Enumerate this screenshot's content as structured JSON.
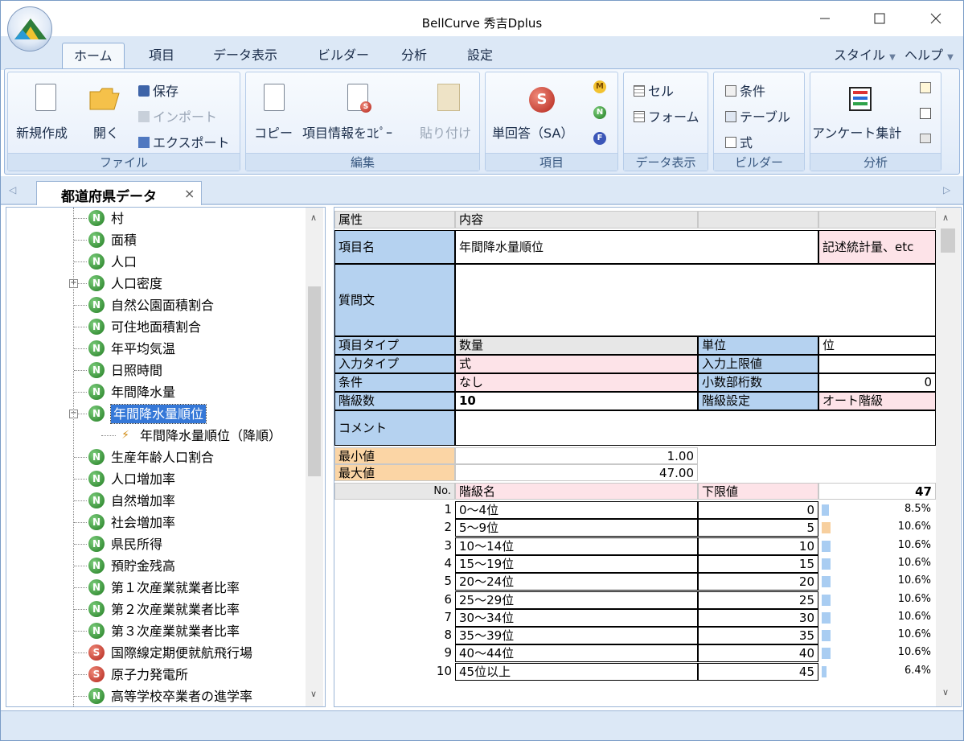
{
  "window": {
    "title": "BellCurve 秀吉Dplus"
  },
  "ribbon_tabs": [
    "ホーム",
    "項目",
    "データ表示",
    "ビルダー",
    "分析",
    "設定"
  ],
  "ribbon_right": {
    "style": "スタイル",
    "help": "ヘルプ"
  },
  "groups": {
    "file": {
      "label": "ファイル",
      "new": "新規作成",
      "open": "開く",
      "save": "保存",
      "import": "インポート",
      "export": "エクスポート"
    },
    "edit": {
      "label": "編集",
      "copy": "コピー",
      "copy_info": "項目情報をｺﾋﾟｰ",
      "paste": "貼り付け"
    },
    "item": {
      "label": "項目",
      "single": "単回答（SA）"
    },
    "data_view": {
      "label": "データ表示",
      "cell": "セル",
      "form": "フォーム"
    },
    "builder": {
      "label": "ビルダー",
      "condition": "条件",
      "table": "テーブル",
      "formula": "式"
    },
    "analysis": {
      "label": "分析",
      "survey": "アンケート集計"
    }
  },
  "doc_tab": {
    "label": "都道府県データ"
  },
  "tree": [
    {
      "icon": "N",
      "label": "村"
    },
    {
      "icon": "N",
      "label": "面積"
    },
    {
      "icon": "N",
      "label": "人口"
    },
    {
      "icon": "N",
      "label": "人口密度",
      "expander": "+"
    },
    {
      "icon": "N",
      "label": "自然公園面積割合"
    },
    {
      "icon": "N",
      "label": "可住地面積割合"
    },
    {
      "icon": "N",
      "label": "年平均気温"
    },
    {
      "icon": "N",
      "label": "日照時間"
    },
    {
      "icon": "N",
      "label": "年間降水量"
    },
    {
      "icon": "N",
      "label": "年間降水量順位",
      "expander": "−",
      "selected": true
    },
    {
      "icon": "F",
      "label": "年間降水量順位（降順）",
      "child": true
    },
    {
      "icon": "N",
      "label": "生産年齢人口割合"
    },
    {
      "icon": "N",
      "label": "人口増加率"
    },
    {
      "icon": "N",
      "label": "自然増加率"
    },
    {
      "icon": "N",
      "label": "社会増加率"
    },
    {
      "icon": "N",
      "label": "県民所得"
    },
    {
      "icon": "N",
      "label": "預貯金残高"
    },
    {
      "icon": "N",
      "label": "第１次産業就業者比率"
    },
    {
      "icon": "N",
      "label": "第２次産業就業者比率"
    },
    {
      "icon": "N",
      "label": "第３次産業就業者比率"
    },
    {
      "icon": "S",
      "label": "国際線定期便就航飛行場"
    },
    {
      "icon": "S",
      "label": "原子力発電所"
    },
    {
      "icon": "N",
      "label": "高等学校卒業者の進学率"
    }
  ],
  "props": {
    "hdr_attr": "属性",
    "hdr_content": "内容",
    "item_name_label": "項目名",
    "item_name": "年間降水量順位",
    "stats_button": "記述統計量、etc",
    "question_label": "質問文",
    "item_type_label": "項目タイプ",
    "item_type": "数量",
    "unit_label": "単位",
    "unit": "位",
    "input_type_label": "入力タイプ",
    "input_type": "式",
    "upper_label": "入力上限値",
    "condition_label": "条件",
    "condition": "なし",
    "decimals_label": "小数部桁数",
    "decimals": "0",
    "classes_label": "階級数",
    "classes": "10",
    "class_setting_label": "階級設定",
    "class_setting": "オート階級",
    "comment_label": "コメント",
    "min_label": "最小値",
    "min": "1.00",
    "max_label": "最大値",
    "max": "47.00",
    "no_label": "No.",
    "class_name_label": "階級名",
    "lower_label": "下限値",
    "total": "47"
  },
  "classes": [
    {
      "no": "1",
      "name": "0～4位",
      "lower": "0",
      "pct": "8.5%",
      "ratio": 0.085,
      "highlight": false
    },
    {
      "no": "2",
      "name": "5～9位",
      "lower": "5",
      "pct": "10.6%",
      "ratio": 0.106,
      "highlight": true
    },
    {
      "no": "3",
      "name": "10～14位",
      "lower": "10",
      "pct": "10.6%",
      "ratio": 0.106,
      "highlight": false
    },
    {
      "no": "4",
      "name": "15～19位",
      "lower": "15",
      "pct": "10.6%",
      "ratio": 0.106,
      "highlight": false
    },
    {
      "no": "5",
      "name": "20～24位",
      "lower": "20",
      "pct": "10.6%",
      "ratio": 0.106,
      "highlight": false
    },
    {
      "no": "6",
      "name": "25～29位",
      "lower": "25",
      "pct": "10.6%",
      "ratio": 0.106,
      "highlight": false
    },
    {
      "no": "7",
      "name": "30～34位",
      "lower": "30",
      "pct": "10.6%",
      "ratio": 0.106,
      "highlight": false
    },
    {
      "no": "8",
      "name": "35～39位",
      "lower": "35",
      "pct": "10.6%",
      "ratio": 0.106,
      "highlight": false
    },
    {
      "no": "9",
      "name": "40～44位",
      "lower": "40",
      "pct": "10.6%",
      "ratio": 0.106,
      "highlight": false
    },
    {
      "no": "10",
      "name": "45位以上",
      "lower": "45",
      "pct": "6.4%",
      "ratio": 0.064,
      "highlight": false
    }
  ],
  "colors": {
    "bar": "#a9cdf2",
    "bar_highlight": "#f7cf9e",
    "selection": "#3578d8"
  }
}
